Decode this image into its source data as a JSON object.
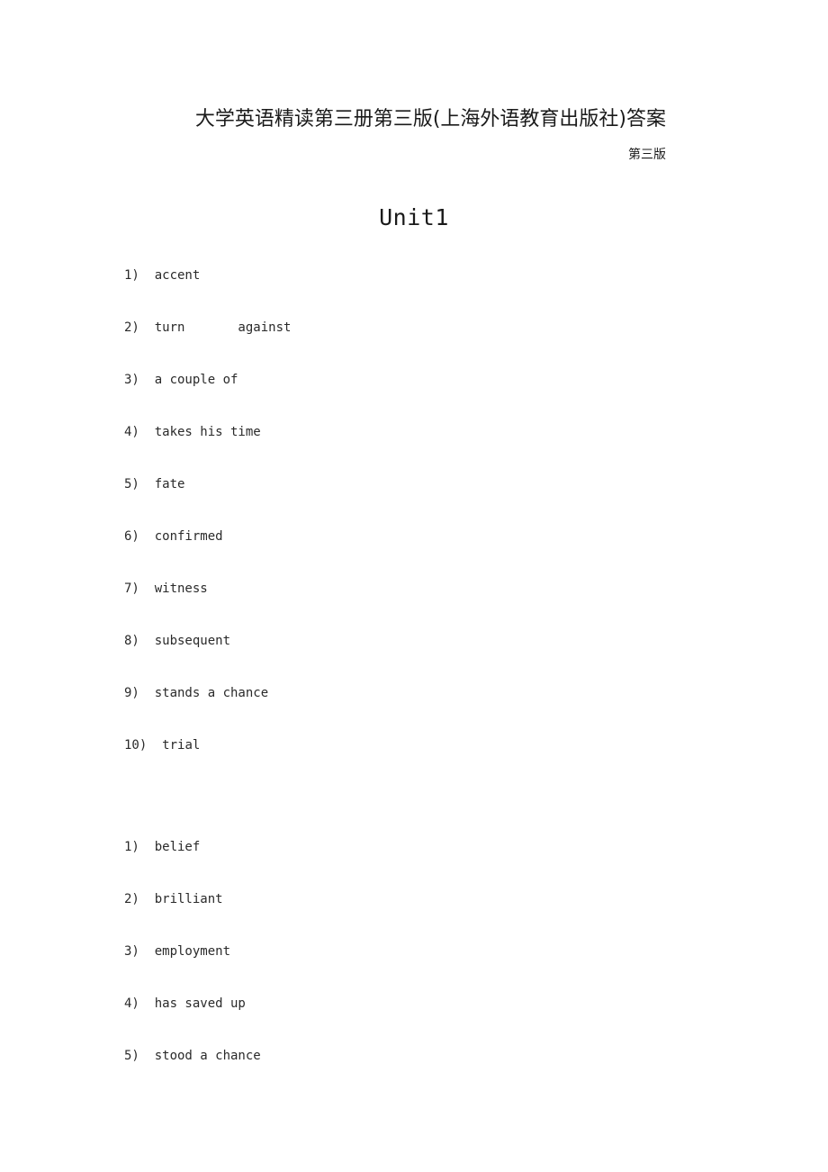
{
  "document": {
    "title": "大学英语精读第三册第三版(上海外语教育出版社)答案",
    "subtitle": "第三版",
    "unit_heading": "Unit1"
  },
  "list_a": {
    "items": [
      {
        "num": "1)",
        "text": "  accent"
      },
      {
        "num": "2)",
        "text": "  turn       against"
      },
      {
        "num": "3)",
        "text": "  a couple of"
      },
      {
        "num": "4)",
        "text": "  takes his time"
      },
      {
        "num": "5)",
        "text": "  fate"
      },
      {
        "num": "6)",
        "text": "  confirmed"
      },
      {
        "num": "7)",
        "text": "  witness"
      },
      {
        "num": "8)",
        "text": "  subsequent"
      },
      {
        "num": "9)",
        "text": "  stands a chance"
      },
      {
        "num": "10)",
        "text": "  trial"
      }
    ]
  },
  "list_b": {
    "items": [
      {
        "num": "1)",
        "text": "  belief"
      },
      {
        "num": "2)",
        "text": "  brilliant"
      },
      {
        "num": "3)",
        "text": "  employment"
      },
      {
        "num": "4)",
        "text": "  has saved up"
      },
      {
        "num": "5)",
        "text": "  stood a chance"
      }
    ]
  },
  "colors": {
    "page_background": "#ffffff",
    "text": "#1a1a1a"
  }
}
